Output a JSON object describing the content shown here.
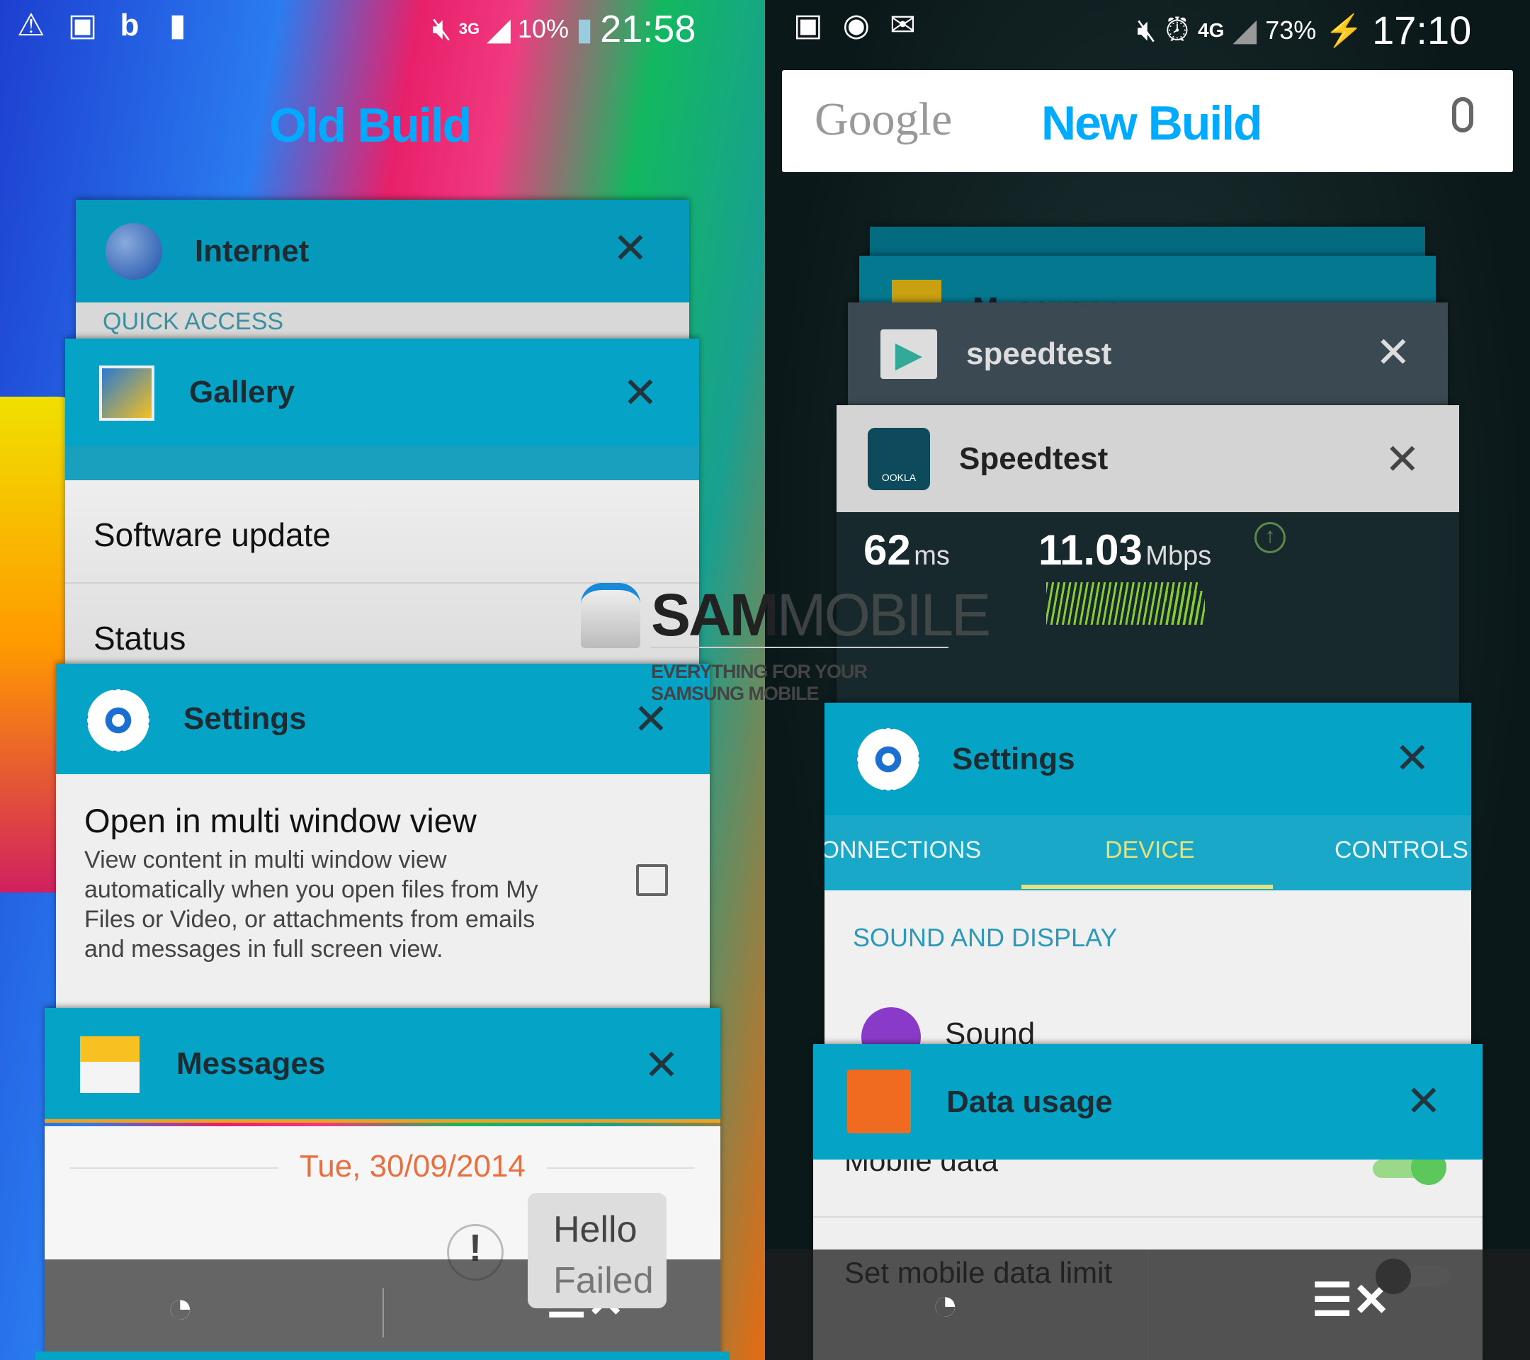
{
  "left": {
    "status_bar": {
      "icons": [
        "warning-icon",
        "image-icon",
        "beats-icon",
        "battery-alert-icon",
        "mute-icon",
        "3g-icon",
        "signal-icon",
        "battery-icon"
      ],
      "network": "3G",
      "battery": "10%",
      "time": "21:58"
    },
    "label": "Old Build",
    "cards": {
      "internet": {
        "title": "Internet",
        "section": "QUICK ACCESS"
      },
      "gallery": {
        "title": "Gallery",
        "items": [
          "Software update",
          "Status"
        ]
      },
      "settings": {
        "title": "Settings",
        "option_title": "Open in multi window view",
        "option_desc": [
          "View content in multi window view",
          "automatically when you open files from My",
          "Files or Video, or attachments from emails",
          "and messages in full screen view."
        ],
        "checked": false
      },
      "messages": {
        "title": "Messages",
        "date": "Tue, 30/09/2014",
        "bubble": [
          "Hello",
          "Failed"
        ]
      }
    }
  },
  "right": {
    "status_bar": {
      "icons": [
        "image-icon",
        "wifi-icon",
        "mail-icon",
        "mute-icon",
        "alarm-icon",
        "4g-icon",
        "signal-icon",
        "battery-charging-icon"
      ],
      "network": "4G",
      "battery": "73%",
      "time": "17:10"
    },
    "search": {
      "logo": "Google",
      "label": "New Build"
    },
    "cards": {
      "messages_peek": {
        "title": "Messages"
      },
      "play": {
        "title": "speedtest"
      },
      "speedtest": {
        "title": "Speedtest",
        "icon_text": "OOKLA",
        "ping": "62",
        "ping_unit": "ms",
        "speed": "11.03",
        "speed_unit": "Mbps"
      },
      "settings": {
        "title": "Settings",
        "tabs": [
          "CONNECTIONS",
          "DEVICE",
          "CONTROLS"
        ],
        "active_tab": "DEVICE",
        "section": "SOUND AND DISPLAY",
        "item": "Sound"
      },
      "data_usage": {
        "title": "Data usage",
        "items": [
          "Mobile data",
          "Set mobile data limit"
        ],
        "mobile_data_on": true,
        "limit_on": false
      }
    }
  },
  "watermark": {
    "brand_bold": "SAM",
    "brand_light": "MOBILE",
    "tagline": "EVERYTHING FOR YOUR SAMSUNG MOBILE"
  },
  "colors": {
    "header": "#05a4c6",
    "accent": "#00aaff",
    "tab_active": "#e8e07a",
    "date": "#e87040"
  }
}
